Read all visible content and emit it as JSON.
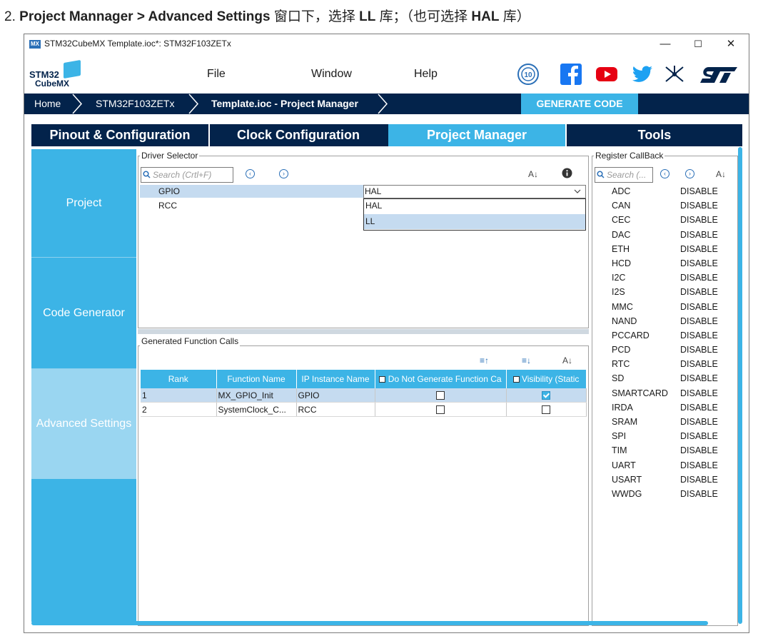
{
  "caption": {
    "prefix": "2.",
    "bold1": "Project Mannager > Advanced Settings",
    "mid": " 窗口下，选择 ",
    "bold2": "LL",
    "mid2": " 库；（也可选择 ",
    "bold3": "HAL",
    "suffix": " 库）"
  },
  "window": {
    "icon": "MX",
    "title": "STM32CubeMX Template.ioc*: STM32F103ZETx",
    "controls": [
      "—",
      "☐",
      "✕"
    ]
  },
  "logo": {
    "line1": "STM32",
    "line2": "CubeMX"
  },
  "menu": [
    "File",
    "Window",
    "Help"
  ],
  "breadcrumb": [
    "Home",
    "STM32F103ZETx",
    "Template.ioc - Project Manager"
  ],
  "generate_button": "GENERATE CODE",
  "tabs": [
    "Pinout & Configuration",
    "Clock Configuration",
    "Project Manager",
    "Tools"
  ],
  "active_tab": "Project Manager",
  "left_nav": [
    "Project",
    "Code Generator",
    "Advanced Settings"
  ],
  "active_nav": "Advanced Settings",
  "driver_selector": {
    "legend": "Driver Selector",
    "search_placeholder": "Search (Crtl+F)",
    "rows": [
      {
        "name": "GPIO",
        "driver": "HAL"
      },
      {
        "name": "RCC",
        "driver": ""
      }
    ],
    "dropdown_options": [
      "HAL",
      "LL"
    ],
    "highlighted_option": "LL"
  },
  "function_calls": {
    "legend": "Generated Function Calls",
    "columns": [
      "Rank",
      "Function Name",
      "IP Instance Name",
      "Do Not Generate Function Ca",
      "Visibility (Static"
    ],
    "rows": [
      {
        "rank": "1",
        "function": "MX_GPIO_Init",
        "ip": "GPIO",
        "no_gen": false,
        "visibility": true
      },
      {
        "rank": "2",
        "function": "SystemClock_C...",
        "ip": "RCC",
        "no_gen": false,
        "visibility": false
      }
    ]
  },
  "register_callback": {
    "legend": "Register CallBack",
    "search_placeholder": "Search (...",
    "items": [
      {
        "name": "ADC",
        "value": "DISABLE"
      },
      {
        "name": "CAN",
        "value": "DISABLE"
      },
      {
        "name": "CEC",
        "value": "DISABLE"
      },
      {
        "name": "DAC",
        "value": "DISABLE"
      },
      {
        "name": "ETH",
        "value": "DISABLE"
      },
      {
        "name": "HCD",
        "value": "DISABLE"
      },
      {
        "name": "I2C",
        "value": "DISABLE"
      },
      {
        "name": "I2S",
        "value": "DISABLE"
      },
      {
        "name": "MMC",
        "value": "DISABLE"
      },
      {
        "name": "NAND",
        "value": "DISABLE"
      },
      {
        "name": "PCCARD",
        "value": "DISABLE"
      },
      {
        "name": "PCD",
        "value": "DISABLE"
      },
      {
        "name": "RTC",
        "value": "DISABLE"
      },
      {
        "name": "SD",
        "value": "DISABLE"
      },
      {
        "name": "SMARTCARD",
        "value": "DISABLE"
      },
      {
        "name": "IRDA",
        "value": "DISABLE"
      },
      {
        "name": "SRAM",
        "value": "DISABLE"
      },
      {
        "name": "SPI",
        "value": "DISABLE"
      },
      {
        "name": "TIM",
        "value": "DISABLE"
      },
      {
        "name": "UART",
        "value": "DISABLE"
      },
      {
        "name": "USART",
        "value": "DISABLE"
      },
      {
        "name": "WWDG",
        "value": "DISABLE"
      }
    ]
  },
  "colors": {
    "navy": "#03234b",
    "accent": "#3cb4e6",
    "nav_active": "#9ad6f1"
  }
}
